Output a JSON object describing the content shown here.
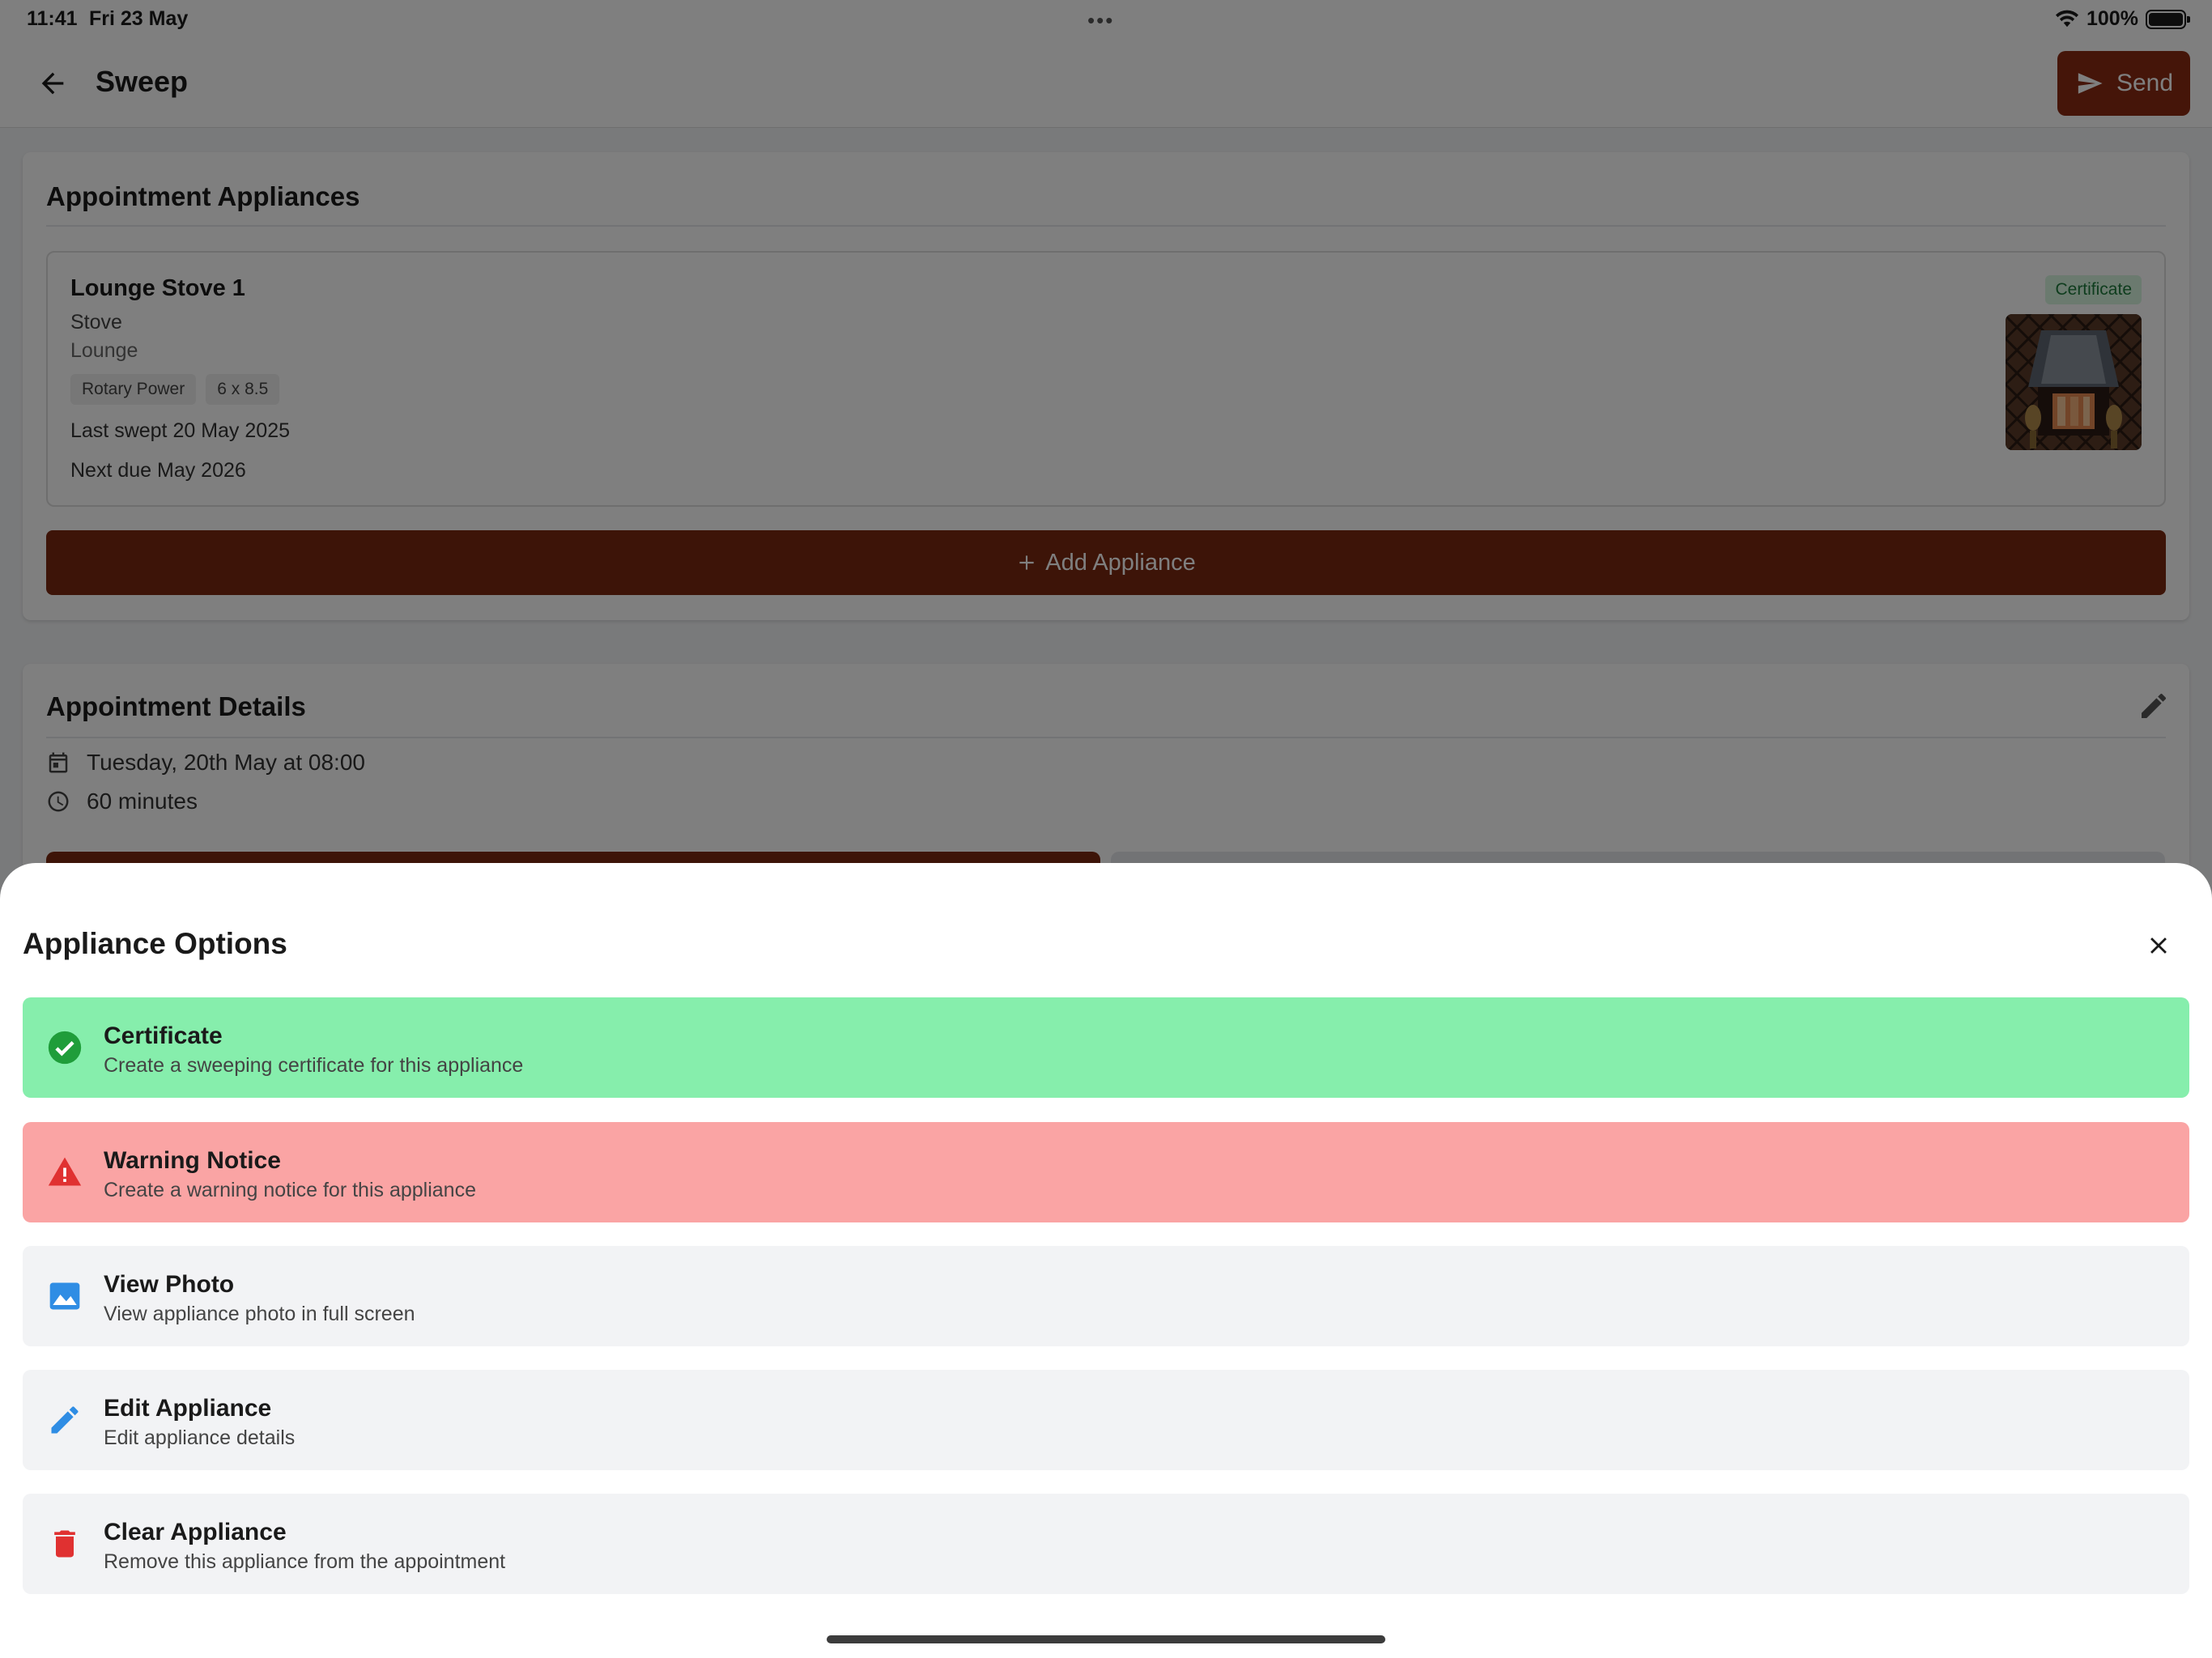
{
  "status_bar": {
    "time": "11:41",
    "date": "Fri 23 May",
    "dots": "•••",
    "battery": "100%"
  },
  "app_bar": {
    "title": "Sweep",
    "send_label": "Send"
  },
  "appliances_card": {
    "title": "Appointment Appliances",
    "appliance": {
      "name": "Lounge Stove 1",
      "type": "Stove",
      "room": "Lounge",
      "chips": [
        "Rotary Power",
        "6 x 8.5"
      ],
      "last_swept": "Last swept 20 May 2025",
      "next_due": "Next due May 2026",
      "badge": "Certificate",
      "photo_icon": "fireplace-photo"
    },
    "add_label": "Add Appliance"
  },
  "details_card": {
    "title": "Appointment Details",
    "date_time": "Tuesday, 20th May at 08:00",
    "duration": "60 minutes"
  },
  "sheet": {
    "title": "Appliance Options",
    "options": [
      {
        "title": "Certificate",
        "subtitle": "Create a sweeping certificate for this appliance",
        "icon": "check-circle-icon"
      },
      {
        "title": "Warning Notice",
        "subtitle": "Create a warning notice for this appliance",
        "icon": "warning-triangle-icon"
      },
      {
        "title": "View Photo",
        "subtitle": "View appliance photo in full screen",
        "icon": "image-icon"
      },
      {
        "title": "Edit Appliance",
        "subtitle": "Edit appliance details",
        "icon": "pencil-icon"
      },
      {
        "title": "Clear Appliance",
        "subtitle": "Remove this appliance from the appointment",
        "icon": "trash-icon"
      }
    ]
  },
  "colors": {
    "brand": "#7a2810",
    "certificate_bg": "#86eeac",
    "warning_bg": "#faa4a4",
    "option_bg": "#f2f3f5",
    "icon_blue": "#2f8de4",
    "icon_red": "#e03131",
    "icon_green": "#1f9d3a"
  }
}
